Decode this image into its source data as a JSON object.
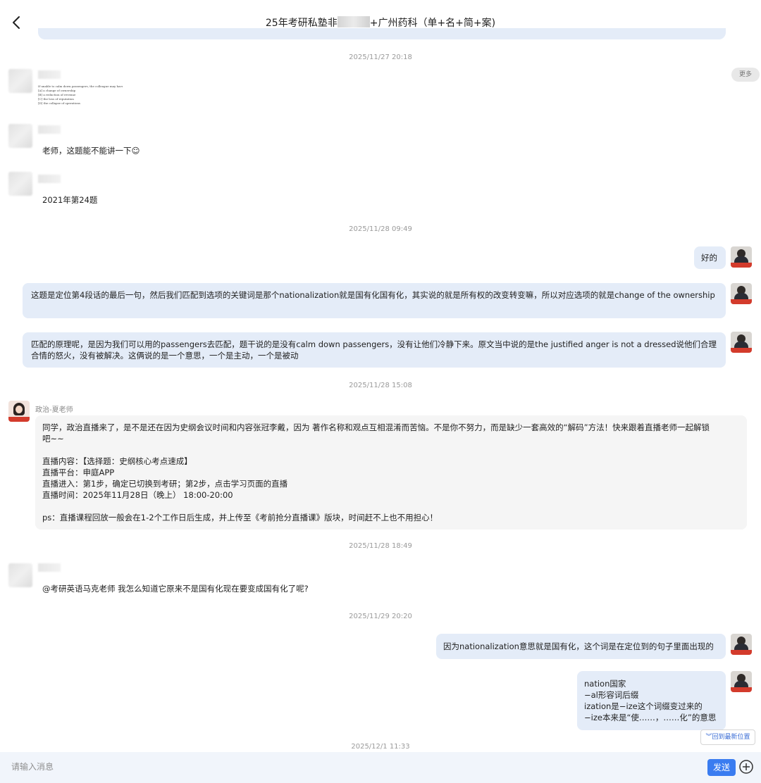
{
  "header": {
    "title_before": "25年考研私塾非",
    "title_after": "+广州药科（单+名+简+案)"
  },
  "timestamps": [
    "2025/11/27 20:18",
    "2025/11/28 09:49",
    "2025/11/28 15:08",
    "2025/11/28 18:49",
    "2025/11/29 20:20",
    "2025/12/1 11:33"
  ],
  "more_label": "更多",
  "snippet": {
    "lines": [
      "If unable to calm down passengers, the colleague may have to face",
      "[A] a change of ownership",
      "[B] a reduction of revenue",
      "[C] the loss of reputation",
      "[D] the collapse of operations"
    ]
  },
  "messages": {
    "student1_q": "老师，这题能不能讲一下☺",
    "student2_q": "2021年第24题",
    "t_ok": "好的",
    "t_explain1": "这题是定位第4段话的最后一句，然后我们匹配到选项的关键词是那个nationalization就是国有化国有化，其实说的就是所有权的改变转变嘛，所以对应选项的就是change of the ownership",
    "t_explain2": "匹配的原理呢，是因为我们可以用的passengers去匹配，题干说的是没有calm down passengers，没有让他们冷静下来。原文当中说的是the justified anger is not a dressed说他们合理合情的怒火，没有被解决。这俩说的是一个意思，一个是主动，一个是被动",
    "sender_name": "政治-夏老师",
    "notice_lines": [
      "同学，政治直播来了，是不是还在因为史纲会议时间和内容张冠李戴，因为 著作名称和观点互相混淆而苦恼。不是你不努力，而是缺少一套高效的“解码”方法！快来跟着直播老师一起解锁",
      "吧~~",
      "",
      "直播内容：【选择题：史纲核心考点速成】",
      "直播平台：申庭APP",
      "直播进入：第1步，确定已切换到考研；第2步，点击学习页面的直播",
      "直播时间：2025年11月28日（晚上） 18:00-20:00",
      "",
      "ps：直播课程回放一般会在1-2个工作日后生成，并上传至《考前抢分直播课》版块，时间赶不上也不用担心！"
    ],
    "student3_q": "@考研英语马克老师 我怎么知道它原来不是国有化现在要变成国有化了呢?",
    "t_reply1": "因为nationalization意思就是国有化，这个词是在定位到的句子里面出现的",
    "t_reply2_lines": [
      "nation国家",
      "−al形容词后缀",
      "ization是−ize这个词缀变过来的",
      "−ize本来是“使……，……化”的意思"
    ]
  },
  "scroll_latest_label": "回到最新位置",
  "input": {
    "placeholder": "请输入消息",
    "value": ""
  },
  "send_label": "发送"
}
